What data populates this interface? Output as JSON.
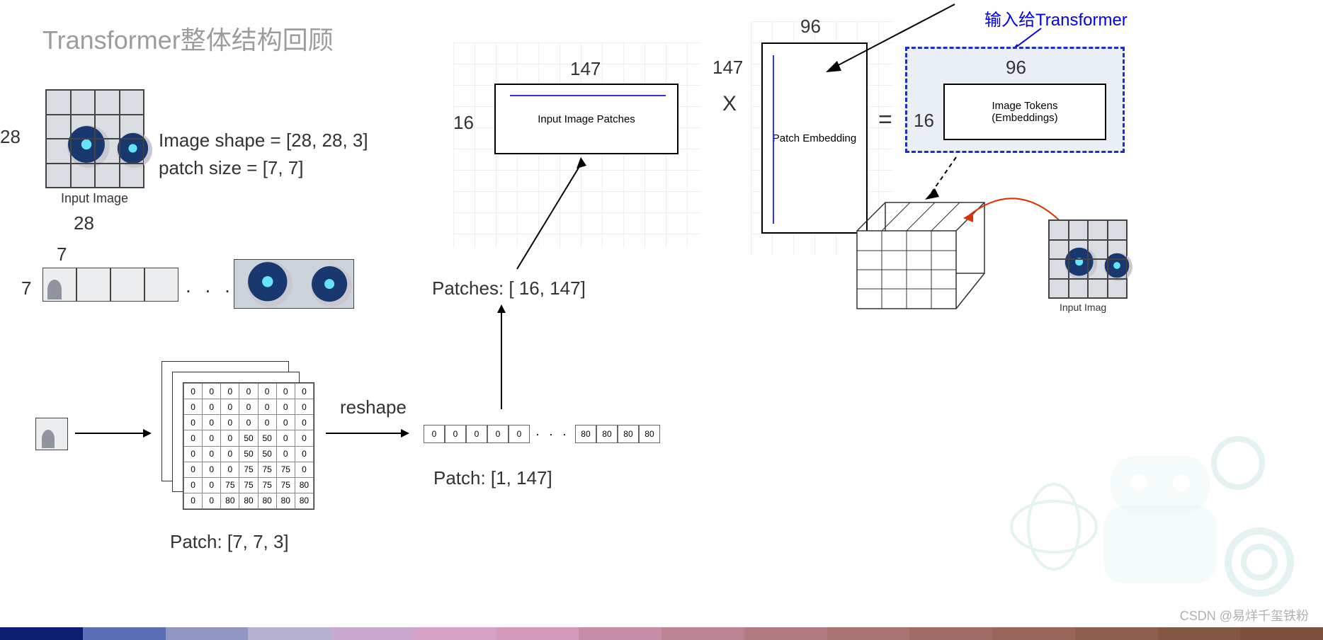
{
  "title": "Transformer整体结构回顾",
  "left": {
    "dim28_left": "28",
    "dim28_bottom": "28",
    "input_image_caption": "Input Image",
    "shape_line": "Image shape = [28, 28, 3]",
    "patch_line": "patch size = [7, 7]",
    "dim7_top": "7",
    "dim7_left": "7",
    "ellipsis": ". . .",
    "patch_label": "Patch: [7, 7, 3]",
    "reshape": "reshape",
    "row_label": "Patch: [1, 147]"
  },
  "matrix": {
    "rows": [
      [
        0,
        0,
        0,
        0,
        0,
        0,
        0
      ],
      [
        0,
        0,
        0,
        0,
        0,
        0,
        0
      ],
      [
        0,
        0,
        0,
        0,
        0,
        0,
        0
      ],
      [
        0,
        0,
        0,
        50,
        50,
        0,
        0
      ],
      [
        0,
        0,
        0,
        50,
        50,
        0,
        0
      ],
      [
        0,
        0,
        0,
        75,
        75,
        75,
        0
      ],
      [
        0,
        0,
        75,
        75,
        75,
        75,
        80
      ],
      [
        0,
        0,
        80,
        80,
        80,
        80,
        80
      ]
    ]
  },
  "rowvec": {
    "left_cells": [
      "0",
      "0",
      "0",
      "0",
      "0"
    ],
    "right_cells": [
      "80",
      "80",
      "80",
      "80"
    ]
  },
  "center": {
    "patches_147": "147",
    "patches_16": "16",
    "patches_box": "Input Image Patches",
    "patches_caption": "Patches: [ 16, 147]",
    "times": "X",
    "embed_147": "147",
    "embed_96": "96",
    "embed_box": "Patch Embedding",
    "equals": "="
  },
  "right": {
    "annot": "输入给Transformer",
    "tokens_96": "96",
    "tokens_16": "16",
    "tokens_box_l1": "Image Tokens",
    "tokens_box_l2": "(Embeddings)",
    "small_caption": "Input Imag"
  },
  "watermark": "CSDN @易烊千玺铁粉",
  "footer_colors": [
    "#0a1d6e",
    "#5a6fb8",
    "#9196c4",
    "#b6b0d0",
    "#caa9ce",
    "#d6a1c6",
    "#d49abb",
    "#c88ea7",
    "#bb8493",
    "#b27b82",
    "#a97373",
    "#a06c66",
    "#97655a",
    "#8e5e4f",
    "#855745",
    "#7c503c"
  ]
}
